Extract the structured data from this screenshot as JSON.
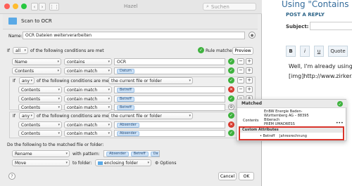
{
  "forum": {
    "title": "Using \"Contains M",
    "post_reply": "POST A REPLY",
    "subject_label": "Subject:",
    "toolbar": [
      "B",
      "i",
      "u",
      "Quote"
    ],
    "body_line1": "Well, I'm already using a n",
    "body_line2": "[img]http://www.zirker.d"
  },
  "app": {
    "title": "Hazel",
    "search_placeholder": "Suchen"
  },
  "rule": {
    "folder_title": "Scan to OCR",
    "name_label": "Name:",
    "name_value": "OCR Dateien weiterverarbeiten",
    "if_label": "If",
    "if_mode": "all",
    "if_suffix": "of the following conditions are met",
    "rule_matches": "Rule matches",
    "preview": "Preview",
    "conditions": [
      {
        "attr": "Name",
        "op": "contains",
        "value": "OCR"
      },
      {
        "attr": "Contents",
        "op": "contain match",
        "token": "Datum"
      }
    ],
    "nested_groups": [
      {
        "if": "If",
        "mode": "any",
        "mid": "of the following conditions are met for",
        "scope": "the current file or folder",
        "rows": [
          {
            "attr": "Contents",
            "op": "contain match",
            "token": "Betreff"
          },
          {
            "attr": "Contents",
            "op": "contain match",
            "token": "Betreff"
          },
          {
            "attr": "Contents",
            "op": "contain match",
            "token": "Betreff"
          }
        ]
      },
      {
        "if": "If",
        "mode": "any",
        "mid": "of the following conditions are met for",
        "scope": "the current file or folder",
        "rows": [
          {
            "attr": "Contents",
            "op": "contain match",
            "token": "Absender"
          },
          {
            "attr": "Contents",
            "op": "contain match",
            "token": "Absender"
          }
        ]
      }
    ],
    "do_label": "Do the following to the matched file or folder:",
    "actions": [
      {
        "action": "Rename",
        "mid": "with pattern:",
        "tokens": [
          "Absender",
          "Betreff",
          "Da"
        ]
      },
      {
        "action": "Move",
        "mid": "to folder:",
        "folder": "enclosing folder",
        "options": "Options"
      }
    ],
    "help": "?",
    "cancel": "Cancel",
    "ok": "OK"
  },
  "popup": {
    "matched_title": "Matched",
    "contents_label": "Contents",
    "contents_lines": [
      "EnBW Energie Baden-",
      "Württemberg AG – 88395",
      "Biberach",
      "PREM UMADRESS"
    ],
    "custom_title": "Custom Attributes",
    "attr_name": "Betreff",
    "attr_value": "Jahresrechnung",
    "more": "•••"
  },
  "colors": {
    "ok_green": "#3eb23e",
    "error_red": "#d8382d",
    "token_blue": "#cfe3f7",
    "highlight_red": "#d9342b"
  }
}
